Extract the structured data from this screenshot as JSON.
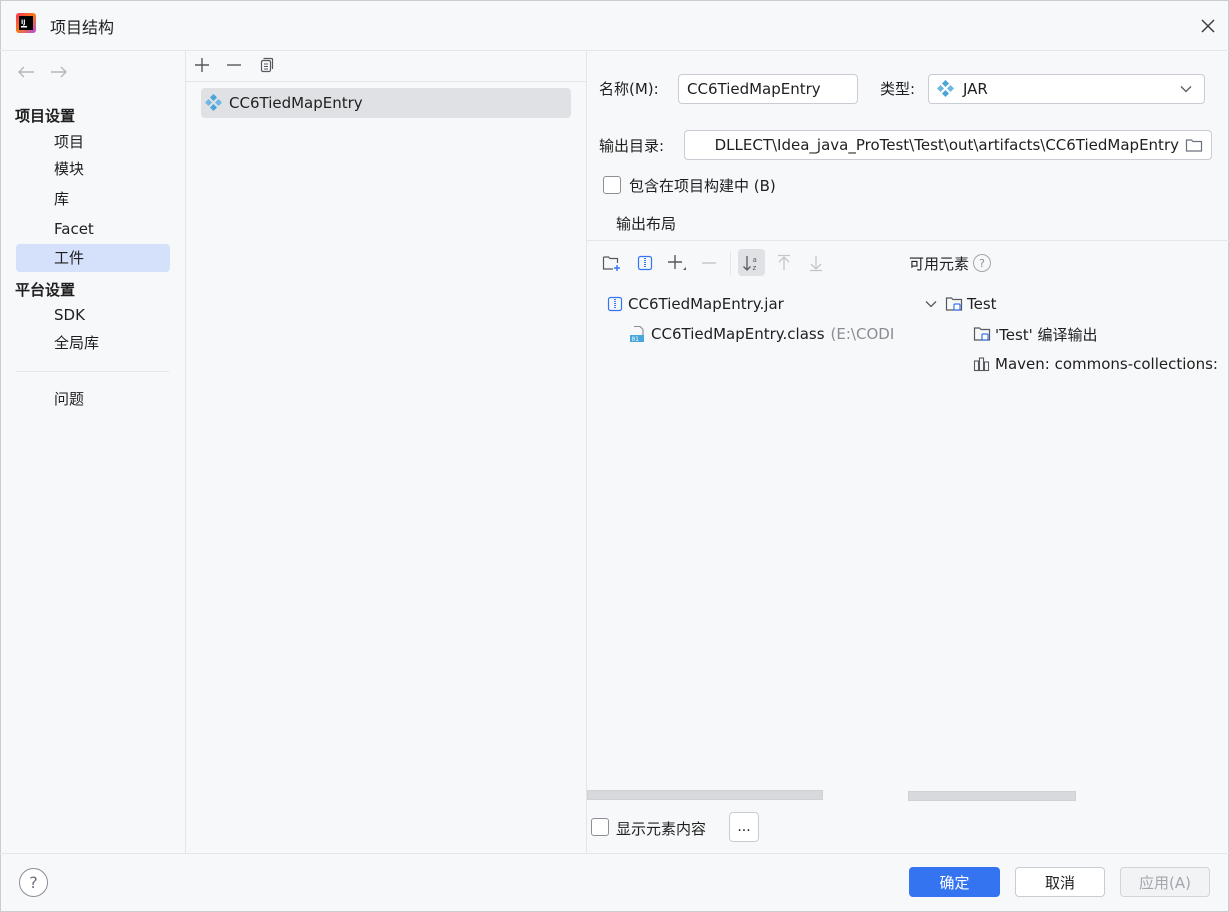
{
  "window": {
    "title": "项目结构"
  },
  "sidebar": {
    "project_settings_header": "项目设置",
    "project_items": [
      {
        "label": "项目"
      },
      {
        "label": "模块"
      },
      {
        "label": "库"
      },
      {
        "label": "Facet"
      },
      {
        "label": "工件",
        "selected": true
      }
    ],
    "platform_settings_header": "平台设置",
    "platform_items": [
      {
        "label": "SDK"
      },
      {
        "label": "全局库"
      }
    ],
    "problems_label": "问题"
  },
  "artifacts": {
    "list": [
      {
        "name": "CC6TiedMapEntry"
      }
    ]
  },
  "form": {
    "name_label": "名称(M):",
    "name_value": "CC6TiedMapEntry",
    "type_label": "类型:",
    "type_value": "JAR",
    "output_dir_label": "输出目录:",
    "output_dir_value": "DLLECT\\Idea_java_ProTest\\Test\\out\\artifacts\\CC6TiedMapEntry",
    "include_in_build_label": "包含在项目构建中 (B)",
    "include_in_build_checked": false,
    "output_layout_tab": "输出布局"
  },
  "layout_tree": [
    {
      "label": "CC6TiedMapEntry.jar",
      "icon": "jar-archive-icon"
    },
    {
      "label": "CC6TiedMapEntry.class",
      "suffix": "(E:\\CODI",
      "icon": "class-file-icon"
    }
  ],
  "available": {
    "header": "可用元素",
    "tree": [
      {
        "label": "Test",
        "icon": "module-folder-icon"
      },
      {
        "label": "'Test' 编译输出",
        "icon": "module-folder-icon"
      },
      {
        "label": "Maven: commons-collections:",
        "icon": "library-icon"
      }
    ]
  },
  "show_content_label": "显示元素内容",
  "show_content_checked": false,
  "ellipsis_label": "...",
  "footer": {
    "help_label": "?",
    "ok_label": "确定",
    "cancel_label": "取消",
    "apply_label": "应用(A)"
  },
  "colors": {
    "accent": "#3574f0",
    "selection": "#d5e1fb",
    "background": "#f7f8fa"
  }
}
